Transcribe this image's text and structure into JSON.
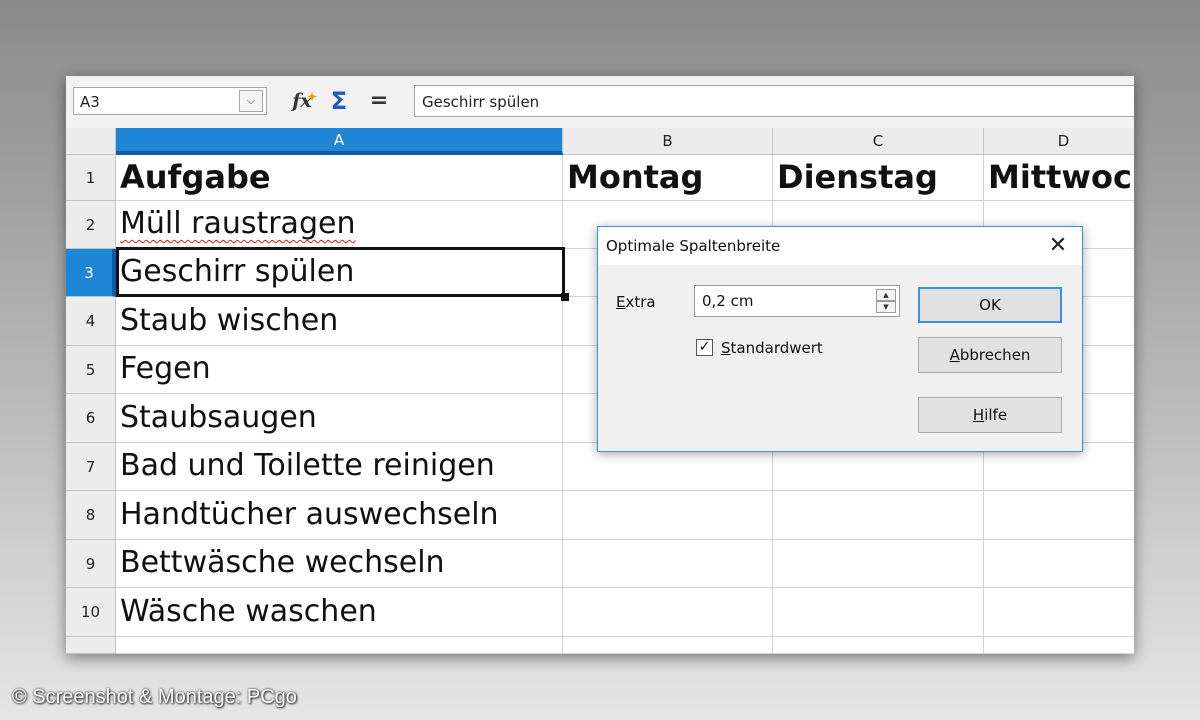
{
  "formula_bar": {
    "name_box": "A3",
    "name_box_dropdown_icon": "chevron-down-icon",
    "function_wizard_icon": "fx-icon",
    "sum_icon": "sigma-icon",
    "formula_icon": "equals-icon",
    "formula_value": "Geschirr spülen"
  },
  "sheet": {
    "columns": [
      {
        "id": "A",
        "label": "A"
      },
      {
        "id": "B",
        "label": "B"
      },
      {
        "id": "C",
        "label": "C"
      },
      {
        "id": "D",
        "label": "D"
      }
    ],
    "selected_column": "A",
    "selected_row": "3",
    "active_cell": "A3",
    "rows": [
      {
        "label": "1",
        "cells": [
          "Aufgabe",
          "Montag",
          "Dienstag",
          "Mittwoch"
        ]
      },
      {
        "label": "2",
        "cells": [
          "Müll raustragen",
          "",
          "",
          ""
        ]
      },
      {
        "label": "3",
        "cells": [
          "Geschirr spülen",
          "",
          "",
          ""
        ]
      },
      {
        "label": "4",
        "cells": [
          "Staub wischen",
          "",
          "",
          ""
        ]
      },
      {
        "label": "5",
        "cells": [
          "Fegen",
          "",
          "",
          ""
        ]
      },
      {
        "label": "6",
        "cells": [
          "Staubsaugen",
          "",
          "",
          ""
        ]
      },
      {
        "label": "7",
        "cells": [
          "Bad und Toilette reinigen",
          "",
          "",
          ""
        ]
      },
      {
        "label": "8",
        "cells": [
          "Handtücher auswechseln",
          "",
          "",
          ""
        ]
      },
      {
        "label": "9",
        "cells": [
          "Bettwäsche wechseln",
          "",
          "",
          ""
        ]
      },
      {
        "label": "10",
        "cells": [
          "Wäsche waschen",
          "",
          "",
          ""
        ]
      }
    ]
  },
  "dialog": {
    "title": "Optimale Spaltenbreite",
    "close_icon": "close-icon",
    "extra_label_accel": "E",
    "extra_label_rest": "xtra",
    "extra_value": "0,2 cm",
    "default_checked": true,
    "default_label_accel": "S",
    "default_label_rest": "tandardwert",
    "ok_label": "OK",
    "cancel_label_accel": "A",
    "cancel_label_rest": "bbrechen",
    "help_label_accel": "H",
    "help_label_rest": "ilfe"
  },
  "colors": {
    "selection_header": "#1e86d4",
    "dialog_border": "#3c8fd8"
  },
  "credit": "© Screenshot & Montage: PCgo"
}
